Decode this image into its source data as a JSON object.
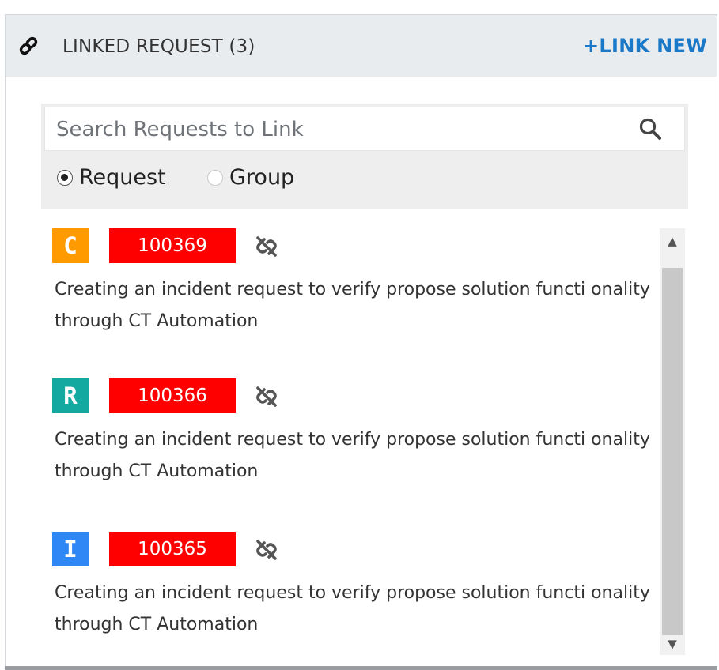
{
  "header": {
    "title": "LINKED REQUEST (3)",
    "link_new_label": "+LINK NEW",
    "icon": "link-icon"
  },
  "search": {
    "placeholder": "Search Requests to Link",
    "value": "",
    "icon": "search-icon"
  },
  "filter": {
    "options": [
      {
        "label": "Request",
        "checked": true
      },
      {
        "label": "Group",
        "checked": false
      }
    ]
  },
  "requests": [
    {
      "type": "C",
      "type_color": "#ff9a00",
      "id": "100369",
      "description": "Creating an incident request to verify propose solution functi onality through CT Automation"
    },
    {
      "type": "R",
      "type_color": "#13a8a0",
      "id": "100366",
      "description": "Creating an incident request to verify propose solution functi onality through CT Automation"
    },
    {
      "type": "I",
      "type_color": "#2f86f5",
      "id": "100365",
      "description": "Creating an incident request to verify propose solution functi onality through CT Automation"
    }
  ],
  "colors": {
    "id_badge": "#ff0000",
    "accent": "#1a78c8",
    "header_bg": "#e8ecef"
  }
}
